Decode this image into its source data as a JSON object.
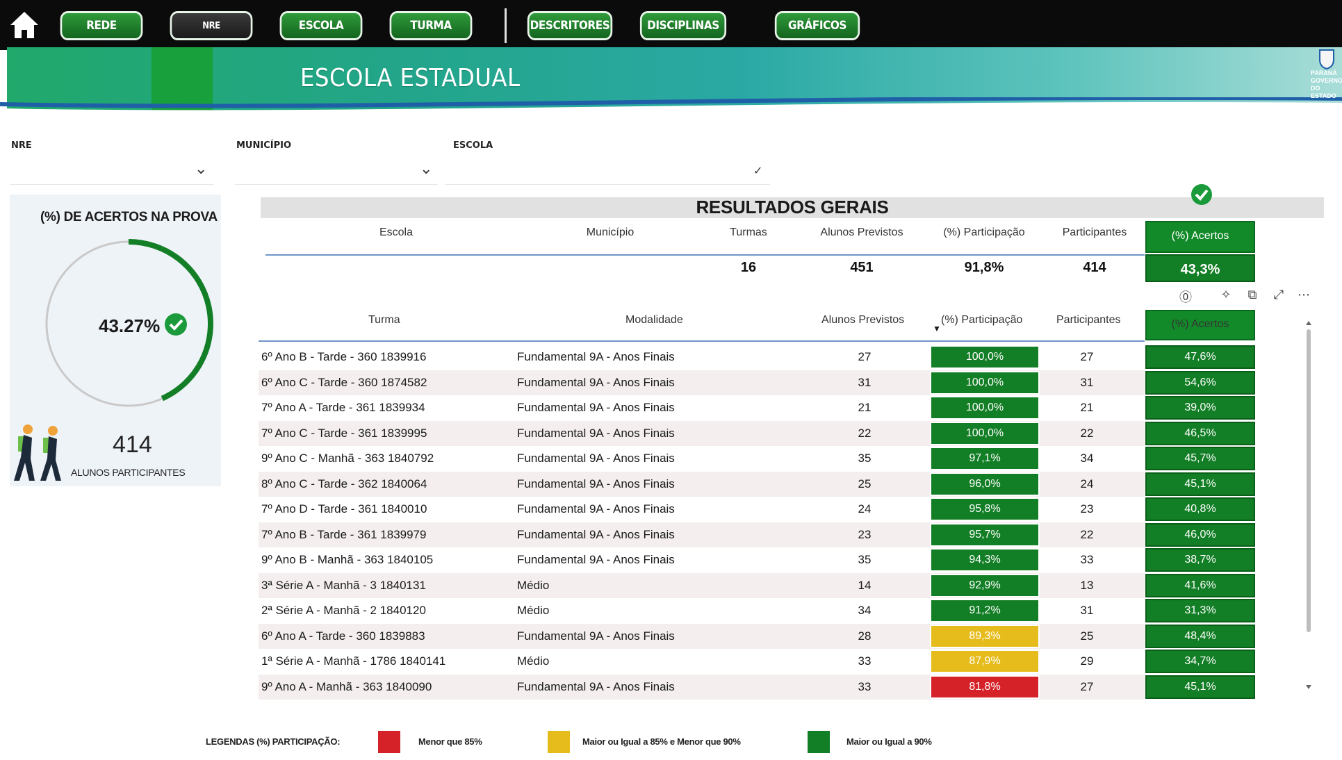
{
  "nav": {
    "buttons": [
      "REDE",
      "NRE",
      "ESCOLA",
      "TURMA",
      "DESCRITORES",
      "DISCIPLINAS",
      "GRÁFICOS"
    ]
  },
  "banner": {
    "title": "ESCOLA ESTADUAL",
    "logo_text": "PARANÁ GOVERNO DO ESTADO"
  },
  "filters": {
    "nre_label": "NRE",
    "municipio_label": "MUNICÍPIO",
    "escola_label": "ESCOLA"
  },
  "kpi": {
    "title": "(%) DE ACERTOS NA PROVA",
    "value": "43.27%",
    "gauge_fraction": 0.4327,
    "participants": "414",
    "participants_label": "ALUNOS PARTICIPANTES"
  },
  "summary": {
    "title": "RESULTADOS GERAIS",
    "headers": [
      "Escola",
      "Município",
      "Turmas",
      "Alunos Previstos",
      "(%) Participação",
      "Participantes",
      "(%) Acertos"
    ],
    "values": {
      "escola": "",
      "municipio": "",
      "turmas": "16",
      "alunos_previstos": "451",
      "participacao": "91,8%",
      "participantes": "414",
      "acertos": "43,3%"
    }
  },
  "detail": {
    "headers": [
      "Turma",
      "Modalidade",
      "Alunos Previstos",
      "(%) Participação",
      "Participantes",
      "(%) Acertos"
    ],
    "rows": [
      {
        "turma": "6º Ano B - Tarde - 360 1839916",
        "modalidade": "Fundamental 9A - Anos Finais",
        "previstos": "27",
        "participacao": "100,0%",
        "status": "green",
        "participantes": "27",
        "acertos": "47,6%"
      },
      {
        "turma": "6º Ano C - Tarde - 360 1874582",
        "modalidade": "Fundamental 9A - Anos Finais",
        "previstos": "31",
        "participacao": "100,0%",
        "status": "green",
        "participantes": "31",
        "acertos": "54,6%"
      },
      {
        "turma": "7º Ano A - Tarde - 361 1839934",
        "modalidade": "Fundamental 9A - Anos Finais",
        "previstos": "21",
        "participacao": "100,0%",
        "status": "green",
        "participantes": "21",
        "acertos": "39,0%"
      },
      {
        "turma": "7º Ano C - Tarde - 361 1839995",
        "modalidade": "Fundamental 9A - Anos Finais",
        "previstos": "22",
        "participacao": "100,0%",
        "status": "green",
        "participantes": "22",
        "acertos": "46,5%"
      },
      {
        "turma": "9º Ano C - Manhã - 363 1840792",
        "modalidade": "Fundamental 9A - Anos Finais",
        "previstos": "35",
        "participacao": "97,1%",
        "status": "green",
        "participantes": "34",
        "acertos": "45,7%"
      },
      {
        "turma": "8º Ano C - Tarde - 362 1840064",
        "modalidade": "Fundamental 9A - Anos Finais",
        "previstos": "25",
        "participacao": "96,0%",
        "status": "green",
        "participantes": "24",
        "acertos": "45,1%"
      },
      {
        "turma": "7º Ano D - Tarde - 361 1840010",
        "modalidade": "Fundamental 9A - Anos Finais",
        "previstos": "24",
        "participacao": "95,8%",
        "status": "green",
        "participantes": "23",
        "acertos": "40,8%"
      },
      {
        "turma": "7º Ano B - Tarde - 361 1839979",
        "modalidade": "Fundamental 9A - Anos Finais",
        "previstos": "23",
        "participacao": "95,7%",
        "status": "green",
        "participantes": "22",
        "acertos": "46,0%"
      },
      {
        "turma": "9º Ano B - Manhã - 363 1840105",
        "modalidade": "Fundamental 9A - Anos Finais",
        "previstos": "35",
        "participacao": "94,3%",
        "status": "green",
        "participantes": "33",
        "acertos": "38,7%"
      },
      {
        "turma": "3ª Série A - Manhã - 3 1840131",
        "modalidade": "Médio",
        "previstos": "14",
        "participacao": "92,9%",
        "status": "green",
        "participantes": "13",
        "acertos": "41,6%"
      },
      {
        "turma": "2ª Série A - Manhã - 2 1840120",
        "modalidade": "Médio",
        "previstos": "34",
        "participacao": "91,2%",
        "status": "green",
        "participantes": "31",
        "acertos": "31,3%"
      },
      {
        "turma": "6º Ano A - Tarde - 360 1839883",
        "modalidade": "Fundamental 9A - Anos Finais",
        "previstos": "28",
        "participacao": "89,3%",
        "status": "yellow",
        "participantes": "25",
        "acertos": "48,4%"
      },
      {
        "turma": "1ª Série A - Manhã - 1786 1840141",
        "modalidade": "Médio",
        "previstos": "33",
        "participacao": "87,9%",
        "status": "yellow",
        "participantes": "29",
        "acertos": "34,7%"
      },
      {
        "turma": "9º Ano A - Manhã - 363 1840090",
        "modalidade": "Fundamental 9A - Anos Finais",
        "previstos": "33",
        "participacao": "81,8%",
        "status": "red",
        "participantes": "27",
        "acertos": "45,1%"
      }
    ]
  },
  "legend": {
    "title": "LEGENDAS (%) PARTICIPAÇÃO:",
    "items": [
      {
        "label": "Menor que 85%",
        "color": "#d42228"
      },
      {
        "label": "Maior ou Igual a 85% e Menor que 90%",
        "color": "#e6bc1c"
      },
      {
        "label": "Maior ou Igual a 90%",
        "color": "#127e25"
      }
    ]
  },
  "colors": {
    "accent_green": "#127e25",
    "header_bg": "#0b0b0b"
  }
}
